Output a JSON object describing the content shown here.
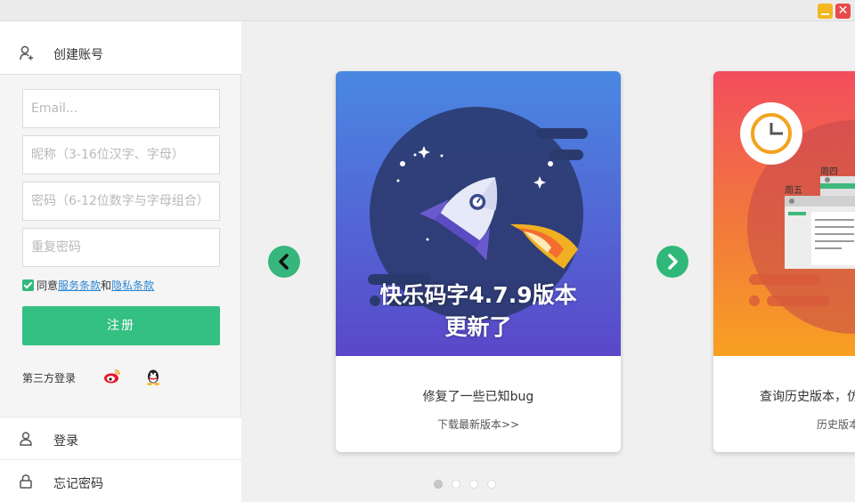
{
  "window": {
    "close_glyph": "✕",
    "minimize_icon": "minimize-icon",
    "close_icon": "close-icon",
    "colors": {
      "minimize": "#f3b720",
      "close": "#e84a4a"
    }
  },
  "register": {
    "title": "创建账号",
    "email_placeholder": "Email...",
    "nickname_placeholder": "昵称（3-16位汉字、字母）",
    "password_placeholder": "密码（6-12位数字与字母组合）",
    "confirm_placeholder": "重复密码",
    "agree_prefix": "同意",
    "terms_link": "服务条款",
    "agree_and": "和",
    "privacy_link": "隐私条款",
    "agree_checked": true,
    "submit_label": "注册",
    "third_party_label": "第三方登录",
    "accent_color": "#35c083"
  },
  "nav": {
    "login_label": "登录",
    "forgot_label": "忘记密码"
  },
  "carousel": {
    "slides": [
      {
        "headline_line1": "快乐码字4.7.9版本",
        "headline_line2": "更新了",
        "subtitle": "修复了一些已知bug",
        "link": "下载最新版本>>"
      },
      {
        "day_label_1": "周四",
        "day_label_2": "周五",
        "subtitle": "查询历史版本，仿",
        "link": "历史版本"
      }
    ],
    "active_index": 0,
    "dot_count": 4,
    "prev_icon": "chevron-left-icon",
    "next_icon": "chevron-right-icon"
  }
}
